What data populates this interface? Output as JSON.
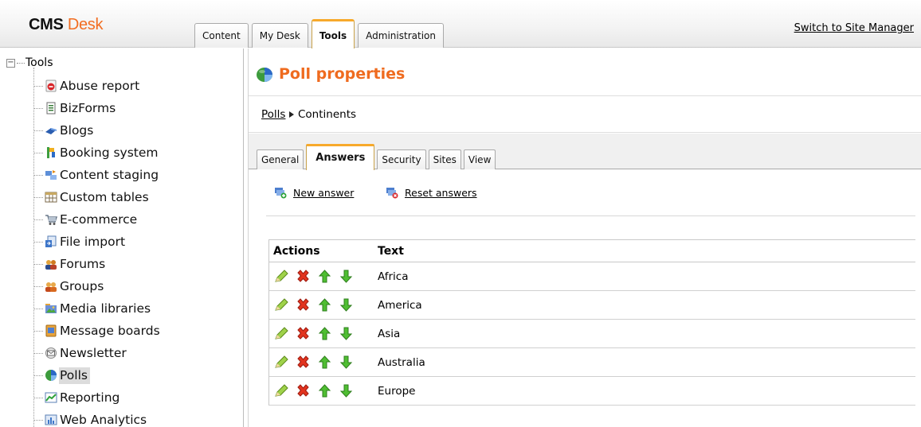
{
  "app": {
    "logo_cms": "CMS",
    "logo_desk": "Desk"
  },
  "main_tabs": [
    {
      "label": "Content",
      "active": false
    },
    {
      "label": "My Desk",
      "active": false
    },
    {
      "label": "Tools",
      "active": true
    },
    {
      "label": "Administration",
      "active": false
    }
  ],
  "switch_link": "Switch to Site Manager",
  "tree": {
    "root_label": "Tools",
    "expander": "−",
    "items": [
      {
        "label": "Abuse report",
        "icon": "abuse-report-icon",
        "selected": false
      },
      {
        "label": "BizForms",
        "icon": "bizforms-icon",
        "selected": false
      },
      {
        "label": "Blogs",
        "icon": "blogs-icon",
        "selected": false
      },
      {
        "label": "Booking system",
        "icon": "booking-system-icon",
        "selected": false
      },
      {
        "label": "Content staging",
        "icon": "content-staging-icon",
        "selected": false
      },
      {
        "label": "Custom tables",
        "icon": "custom-tables-icon",
        "selected": false
      },
      {
        "label": "E-commerce",
        "icon": "ecommerce-icon",
        "selected": false
      },
      {
        "label": "File import",
        "icon": "file-import-icon",
        "selected": false
      },
      {
        "label": "Forums",
        "icon": "forums-icon",
        "selected": false
      },
      {
        "label": "Groups",
        "icon": "groups-icon",
        "selected": false
      },
      {
        "label": "Media libraries",
        "icon": "media-libraries-icon",
        "selected": false
      },
      {
        "label": "Message boards",
        "icon": "message-boards-icon",
        "selected": false
      },
      {
        "label": "Newsletter",
        "icon": "newsletter-icon",
        "selected": false
      },
      {
        "label": "Polls",
        "icon": "polls-icon",
        "selected": true
      },
      {
        "label": "Reporting",
        "icon": "reporting-icon",
        "selected": false
      },
      {
        "label": "Web Analytics",
        "icon": "web-analytics-icon",
        "selected": false
      }
    ]
  },
  "page": {
    "title": "Poll properties",
    "breadcrumb": {
      "parent": "Polls",
      "current": "Continents"
    },
    "tabs": [
      {
        "label": "General",
        "active": false
      },
      {
        "label": "Answers",
        "active": true
      },
      {
        "label": "Security",
        "active": false
      },
      {
        "label": "Sites",
        "active": false
      },
      {
        "label": "View",
        "active": false
      }
    ],
    "actions": {
      "new_answer": "New answer",
      "reset_answers": "Reset answers"
    },
    "grid": {
      "columns": [
        "Actions",
        "Text"
      ],
      "rows": [
        {
          "text": "Africa"
        },
        {
          "text": "America"
        },
        {
          "text": "Asia"
        },
        {
          "text": "Australia"
        },
        {
          "text": "Europe"
        }
      ]
    }
  },
  "colors": {
    "accent": "#ef6b1f",
    "tab_highlight": "#f7a92b"
  }
}
